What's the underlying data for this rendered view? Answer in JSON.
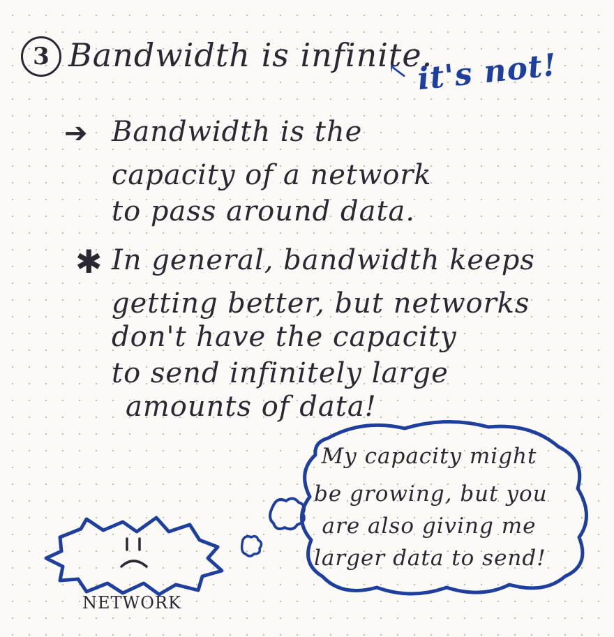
{
  "heading": {
    "number": "3",
    "text": "Bandwidth is infinite.",
    "aside": "it's not!",
    "aside_arrow_icon": "arrow-up-left-icon"
  },
  "definition": {
    "bullet_icon": "arrow-right-icon",
    "lines": [
      "Bandwidth is the",
      "capacity of a network",
      "to pass around data."
    ]
  },
  "note": {
    "bullet_icon": "asterisk-icon",
    "lines": [
      "In general, bandwidth keeps",
      "getting better, but networks",
      "don't have the capacity",
      "to send infinitely large",
      "amounts of data!"
    ]
  },
  "thought_bubble": {
    "lines": [
      "My capacity might",
      "be growing, but you",
      "are also giving me",
      "larger data to send!"
    ]
  },
  "network": {
    "label": "NETWORK",
    "face_icon": "sad-face-icon"
  },
  "colors": {
    "ink_dark": "#2b2733",
    "ink_blue": "#1f3f9e",
    "paper": "#fbfaf7"
  }
}
